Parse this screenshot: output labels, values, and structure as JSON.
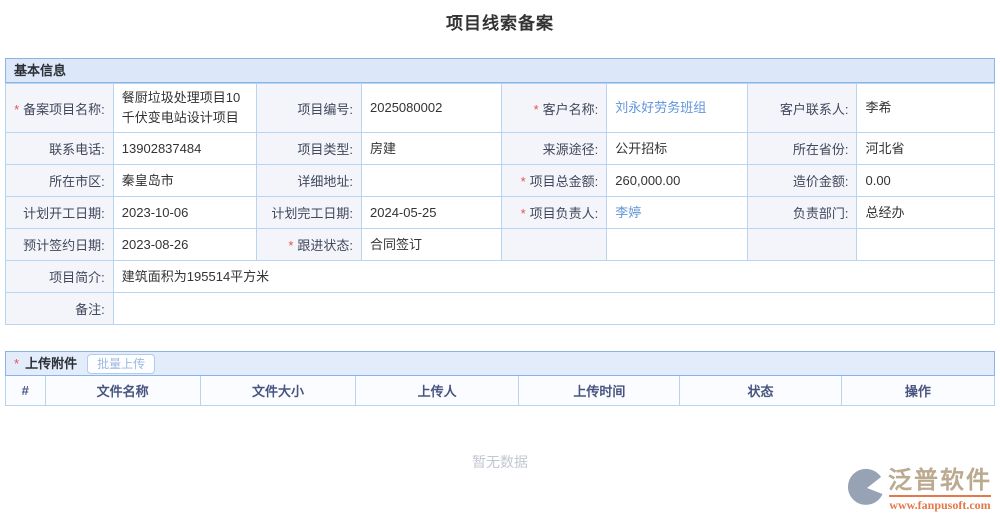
{
  "page": {
    "title": "项目线索备案"
  },
  "marks": {
    "required": "*"
  },
  "colors": {
    "section_border": "#8cb3e6",
    "cell_border": "#b9d4f0",
    "bar_bg": "#dce8fa",
    "label_bg": "#f4f5fa",
    "link": "#6295da",
    "required": "#e8504f",
    "watermark_brand": "#b4a185",
    "watermark_url": "#e06a35"
  },
  "basic_info": {
    "section_title": "基本信息",
    "rows": [
      {
        "cells": [
          {
            "label": "备案项目名称:",
            "required": true
          },
          {
            "value": "餐厨垃圾处理项目10千伏变电站设计项目"
          },
          {
            "label": "项目编号:"
          },
          {
            "value": "2025080002"
          },
          {
            "label": "客户名称:",
            "required": true
          },
          {
            "value": "刘永好劳务班组",
            "link": true
          },
          {
            "label": "客户联系人:"
          },
          {
            "value": "李希"
          }
        ]
      },
      {
        "cells": [
          {
            "label": "联系电话:"
          },
          {
            "value": "13902837484"
          },
          {
            "label": "项目类型:"
          },
          {
            "value": "房建"
          },
          {
            "label": "来源途径:"
          },
          {
            "value": "公开招标"
          },
          {
            "label": "所在省份:"
          },
          {
            "value": "河北省"
          }
        ]
      },
      {
        "cells": [
          {
            "label": "所在市区:"
          },
          {
            "value": "秦皇岛市"
          },
          {
            "label": "详细地址:"
          },
          {
            "value": ""
          },
          {
            "label": "项目总金额:",
            "required": true
          },
          {
            "value": "260,000.00"
          },
          {
            "label": "造价金额:"
          },
          {
            "value": "0.00"
          }
        ]
      },
      {
        "cells": [
          {
            "label": "计划开工日期:"
          },
          {
            "value": "2023-10-06"
          },
          {
            "label": "计划完工日期:"
          },
          {
            "value": "2024-05-25"
          },
          {
            "label": "项目负责人:",
            "required": true
          },
          {
            "value": "李婷",
            "link": true
          },
          {
            "label": "负责部门:"
          },
          {
            "value": "总经办"
          }
        ]
      },
      {
        "cells": [
          {
            "label": "预计签约日期:"
          },
          {
            "value": "2023-08-26"
          },
          {
            "label": "跟进状态:",
            "required": true
          },
          {
            "value": "合同签订"
          },
          {
            "label": ""
          },
          {
            "value": ""
          },
          {
            "label": ""
          },
          {
            "value": ""
          }
        ]
      },
      {
        "cells": [
          {
            "label": "项目简介:"
          },
          {
            "value": "建筑面积为195514平方米"
          }
        ]
      },
      {
        "cells": [
          {
            "label": "备注:"
          },
          {
            "value": ""
          }
        ]
      }
    ]
  },
  "attachments": {
    "section_title": "上传附件",
    "required": true,
    "batch_upload_label": "批量上传",
    "columns": [
      "#",
      "文件名称",
      "文件大小",
      "上传人",
      "上传时间",
      "状态",
      "操作"
    ],
    "empty_text": "暂无数据"
  },
  "watermark": {
    "brand": "泛普软件",
    "url": "www.fanpusoft.com"
  }
}
